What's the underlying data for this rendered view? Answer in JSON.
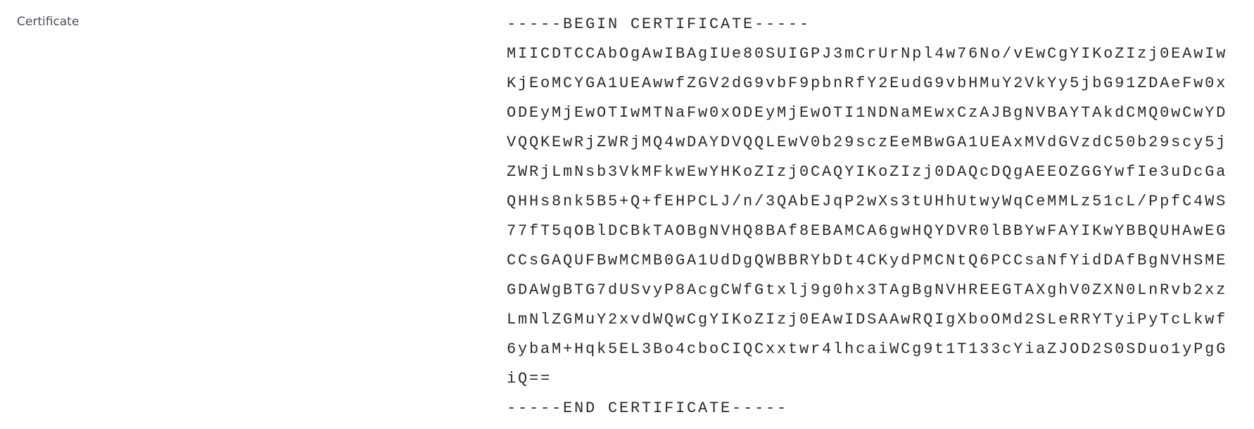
{
  "field": {
    "label": "Certificate",
    "lines": [
      "-----BEGIN CERTIFICATE-----",
      "MIICDTCCAbOgAwIBAgIUe80SUIGPJ3mCrUrNpl4w76No/vEwCgYIKoZIzj0EAwIw",
      "KjEoMCYGA1UEAwwfZGV2dG9vbF9pbnRfY2EudG9vbHMuY2VkYy5jbG91ZDAeFw0x",
      "ODEyMjEwOTIwMTNaFw0xODEyMjEwOTI1NDNaMEwxCzAJBgNVBAYTAkdCMQ0wCwYD",
      "VQQKEwRjZWRjMQ4wDAYDVQQLEwV0b29sczEeMBwGA1UEAxMVdGVzdC50b29scy5j",
      "ZWRjLmNsb3VkMFkwEwYHKoZIzj0CAQYIKoZIzj0DAQcDQgAEEOZGGYwfIe3uDcGa",
      "QHHs8nk5B5+Q+fEHPCLJ/n/3QAbEJqP2wXs3tUHhUtwyWqCeMMLz51cL/PpfC4WS",
      "77fT5qOBlDCBkTAOBgNVHQ8BAf8EBAMCA6gwHQYDVR0lBBYwFAYIKwYBBQUHAwEG",
      "CCsGAQUFBwMCMB0GA1UdDgQWBBRYbDt4CKydPMCNtQ6PCCsaNfYidDAfBgNVHSME",
      "GDAWgBTG7dUSvyP8AcgCWfGtxlj9g0hx3TAgBgNVHREEGTAXghV0ZXN0LnRvb2xz",
      "LmNlZGMuY2xvdWQwCgYIKoZIzj0EAwIDSAAwRQIgXboOMd2SLeRRYTyiPyTcLkwf",
      "6ybaM+Hqk5EL3Bo4cboCIQCxxtwr4lhcaiWCg9t1T133cYiaZJOD2S0SDuo1yPgG",
      "iQ==",
      "-----END CERTIFICATE-----"
    ]
  }
}
